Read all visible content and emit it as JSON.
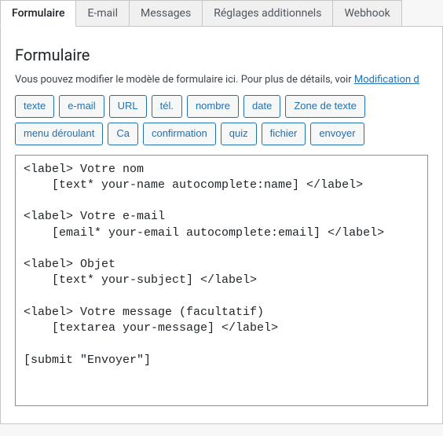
{
  "tabs": [
    {
      "label": "Formulaire",
      "active": true
    },
    {
      "label": "E-mail",
      "active": false
    },
    {
      "label": "Messages",
      "active": false
    },
    {
      "label": "Réglages additionnels",
      "active": false
    },
    {
      "label": "Webhook",
      "active": false
    }
  ],
  "section": {
    "title": "Formulaire",
    "help_prefix": "Vous pouvez modifier le modèle de formulaire ici. Pour plus de détails, voir ",
    "help_link_text": "Modification d"
  },
  "tag_buttons": [
    "texte",
    "e-mail",
    "URL",
    "tél.",
    "nombre",
    "date",
    "Zone de texte",
    "menu déroulant",
    "Ca",
    "confirmation",
    "quiz",
    "fichier",
    "envoyer"
  ],
  "form_template": "<label> Votre nom\n    [text* your-name autocomplete:name] </label>\n\n<label> Votre e-mail\n    [email* your-email autocomplete:email] </label>\n\n<label> Objet\n    [text* your-subject] </label>\n\n<label> Votre message (facultatif)\n    [textarea your-message] </label>\n\n[submit \"Envoyer\"]"
}
